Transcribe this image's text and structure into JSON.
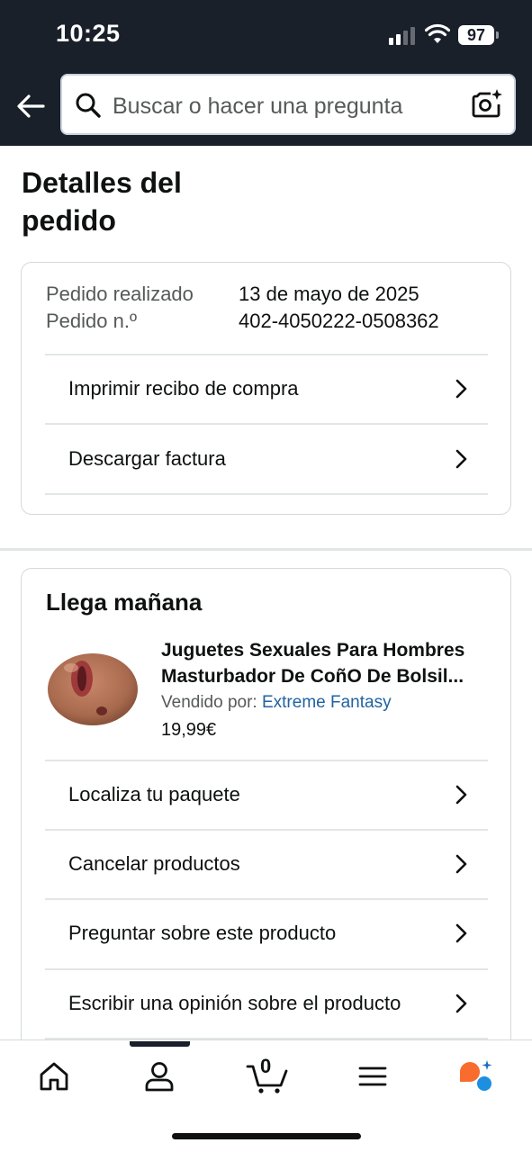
{
  "status_bar": {
    "time": "10:25",
    "battery": "97"
  },
  "header": {
    "back_icon": "arrow-left-icon",
    "search_placeholder": "Buscar o hacer una pregunta",
    "search_icon": "search-icon",
    "camera_icon": "camera-sparkle-icon",
    "background_color": "#1a202a"
  },
  "page": {
    "title": "Detalles del pedido"
  },
  "order_info": {
    "rows": [
      {
        "label": "Pedido realizado",
        "value": "13 de mayo de 2025"
      },
      {
        "label": "Pedido n.º",
        "value": "402-4050222-0508362"
      }
    ],
    "actions": [
      {
        "label": "Imprimir recibo de compra"
      },
      {
        "label": "Descargar factura"
      }
    ]
  },
  "shipment": {
    "heading": "Llega mañana",
    "product": {
      "title_line1": "Juguetes Sexuales Para Hombres",
      "title_line2": "Masturbador De CoñO De Bolsil...",
      "seller_prefix": "Vendido por:",
      "seller_name": "Extreme Fantasy",
      "price": "19,99€"
    },
    "actions": [
      {
        "label": "Localiza tu paquete"
      },
      {
        "label": "Cancelar productos"
      },
      {
        "label": "Preguntar sobre este producto"
      },
      {
        "label": "Escribir una opinión sobre el producto"
      }
    ]
  },
  "bottom_nav": {
    "items": [
      "home-icon",
      "account-icon",
      "cart-icon",
      "menu-icon",
      "rufus-assistant-icon"
    ],
    "cart_count": "0",
    "active_index": 1
  },
  "colors": {
    "link": "#2162a1",
    "text": "#0f1111",
    "secondary_text": "#565959",
    "assistant_orange": "#f86c2e",
    "assistant_blue": "#1c8fe0"
  }
}
